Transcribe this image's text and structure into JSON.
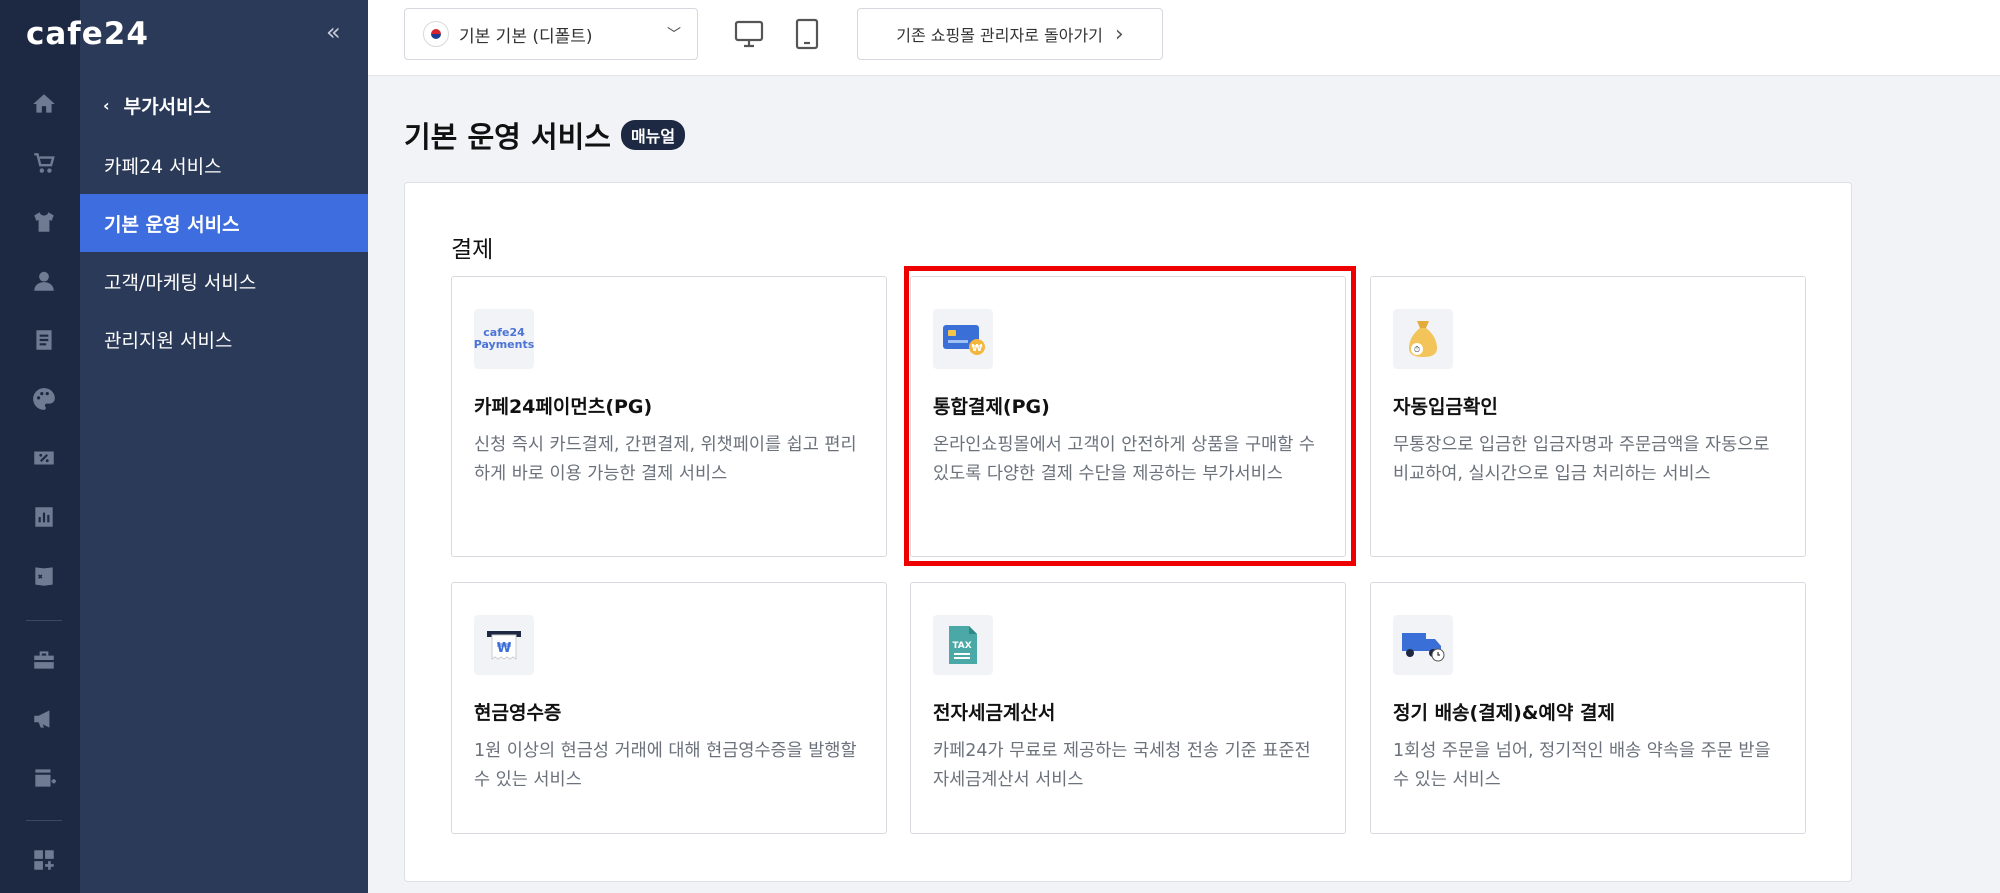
{
  "brand": {
    "logo_text": "cafe24",
    "collapse_glyph": "«"
  },
  "rail": {
    "icons": [
      "home-icon",
      "cart-icon",
      "shirt-icon",
      "person-icon",
      "document-icon",
      "palette-icon",
      "discount-icon",
      "chart-icon",
      "book-icon",
      "toolbox-icon",
      "megaphone-icon",
      "store-add-icon",
      "apps-add-icon"
    ]
  },
  "subnav": {
    "header": "부가서비스",
    "items": [
      {
        "label": "카페24 서비스",
        "active": false
      },
      {
        "label": "기본 운영 서비스",
        "active": true
      },
      {
        "label": "고객/마케팅 서비스",
        "active": false
      },
      {
        "label": "관리지원 서비스",
        "active": false
      }
    ]
  },
  "topbar": {
    "mall_selector": "기본 기본 (디폴트)",
    "back_button": "기존 쇼핑몰 관리자로 돌아가기"
  },
  "page": {
    "title": "기본 운영 서비스",
    "badge": "매뉴얼"
  },
  "section": {
    "title": "결제",
    "cards": [
      {
        "icon": "cafe24-payments-icon",
        "icon_text": "cafe24 Payments",
        "title": "카페24페이먼츠(PG)",
        "desc": "신청 즉시 카드결제, 간편결제, 위챗페이를 쉽고 편리하게 바로 이용 가능한 결제 서비스"
      },
      {
        "icon": "credit-card-icon",
        "title": "통합결제(PG)",
        "desc": "온라인쇼핑몰에서 고객이 안전하게 상품을 구매할 수 있도록 다양한 결제 수단을 제공하는 부가서비스",
        "highlighted": true
      },
      {
        "icon": "money-bag-icon",
        "title": "자동입금확인",
        "desc": "무통장으로 입금한 입금자명과 주문금액을 자동으로 비교하여, 실시간으로 입금 처리하는 서비스"
      },
      {
        "icon": "receipt-icon",
        "title": "현금영수증",
        "desc": "1원 이상의 현금성 거래에 대해 현금영수증을 발행할 수 있는 서비스"
      },
      {
        "icon": "tax-invoice-icon",
        "icon_text": "TAX",
        "title": "전자세금계산서",
        "desc": "카페24가 무료로 제공하는 국세청 전송 기준 표준전자세금계산서 서비스"
      },
      {
        "icon": "delivery-truck-icon",
        "title": "정기 배송(결제)&예약 결제",
        "desc": "1회성 주문을 넘어, 정기적인 배송 약속을 주문 받을 수 있는 서비스"
      }
    ]
  },
  "colors": {
    "rail_bg": "#1d2942",
    "subnav_bg": "#2b3a58",
    "active_item": "#3e6de0",
    "highlight_border": "#ee0000"
  }
}
